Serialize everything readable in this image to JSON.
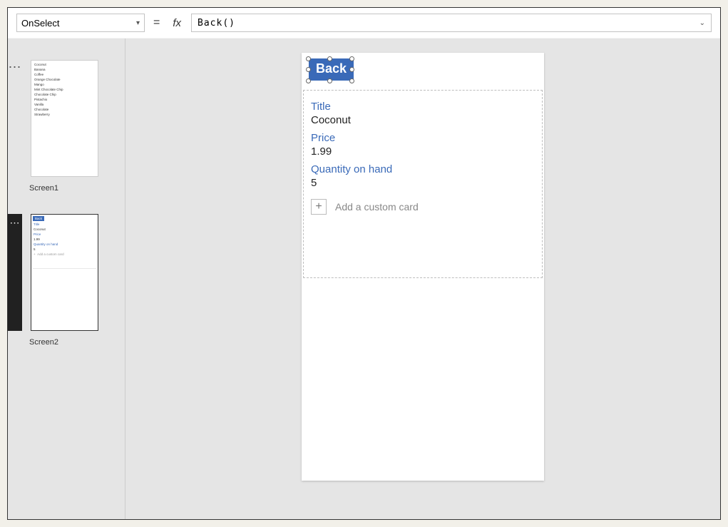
{
  "formula_bar": {
    "property": "OnSelect",
    "equals": "=",
    "fx": "fx",
    "formula": "Back()"
  },
  "screens": {
    "screen1": {
      "label": "Screen1",
      "items": [
        "Coconut",
        "Banana",
        "Coffee",
        "Orange Chocolate",
        "Mango",
        "Mint Chocolate Chip",
        "Chocolate Chip",
        "Pistachio",
        "Vanilla",
        "Chocolate",
        "Strawberry"
      ]
    },
    "screen2": {
      "label": "Screen2",
      "back": "Back",
      "fields": {
        "title_label": "Title",
        "title_value": "Coconut",
        "price_label": "Price",
        "price_value": "1.99",
        "qty_label": "Quantity on hand",
        "qty_value": "5"
      },
      "add_card": "Add a custom card"
    }
  },
  "canvas": {
    "back_button": "Back",
    "fields": {
      "title_label": "Title",
      "title_value": "Coconut",
      "price_label": "Price",
      "price_value": "1.99",
      "qty_label": "Quantity on hand",
      "qty_value": "5"
    },
    "add_card": "Add a custom card"
  }
}
